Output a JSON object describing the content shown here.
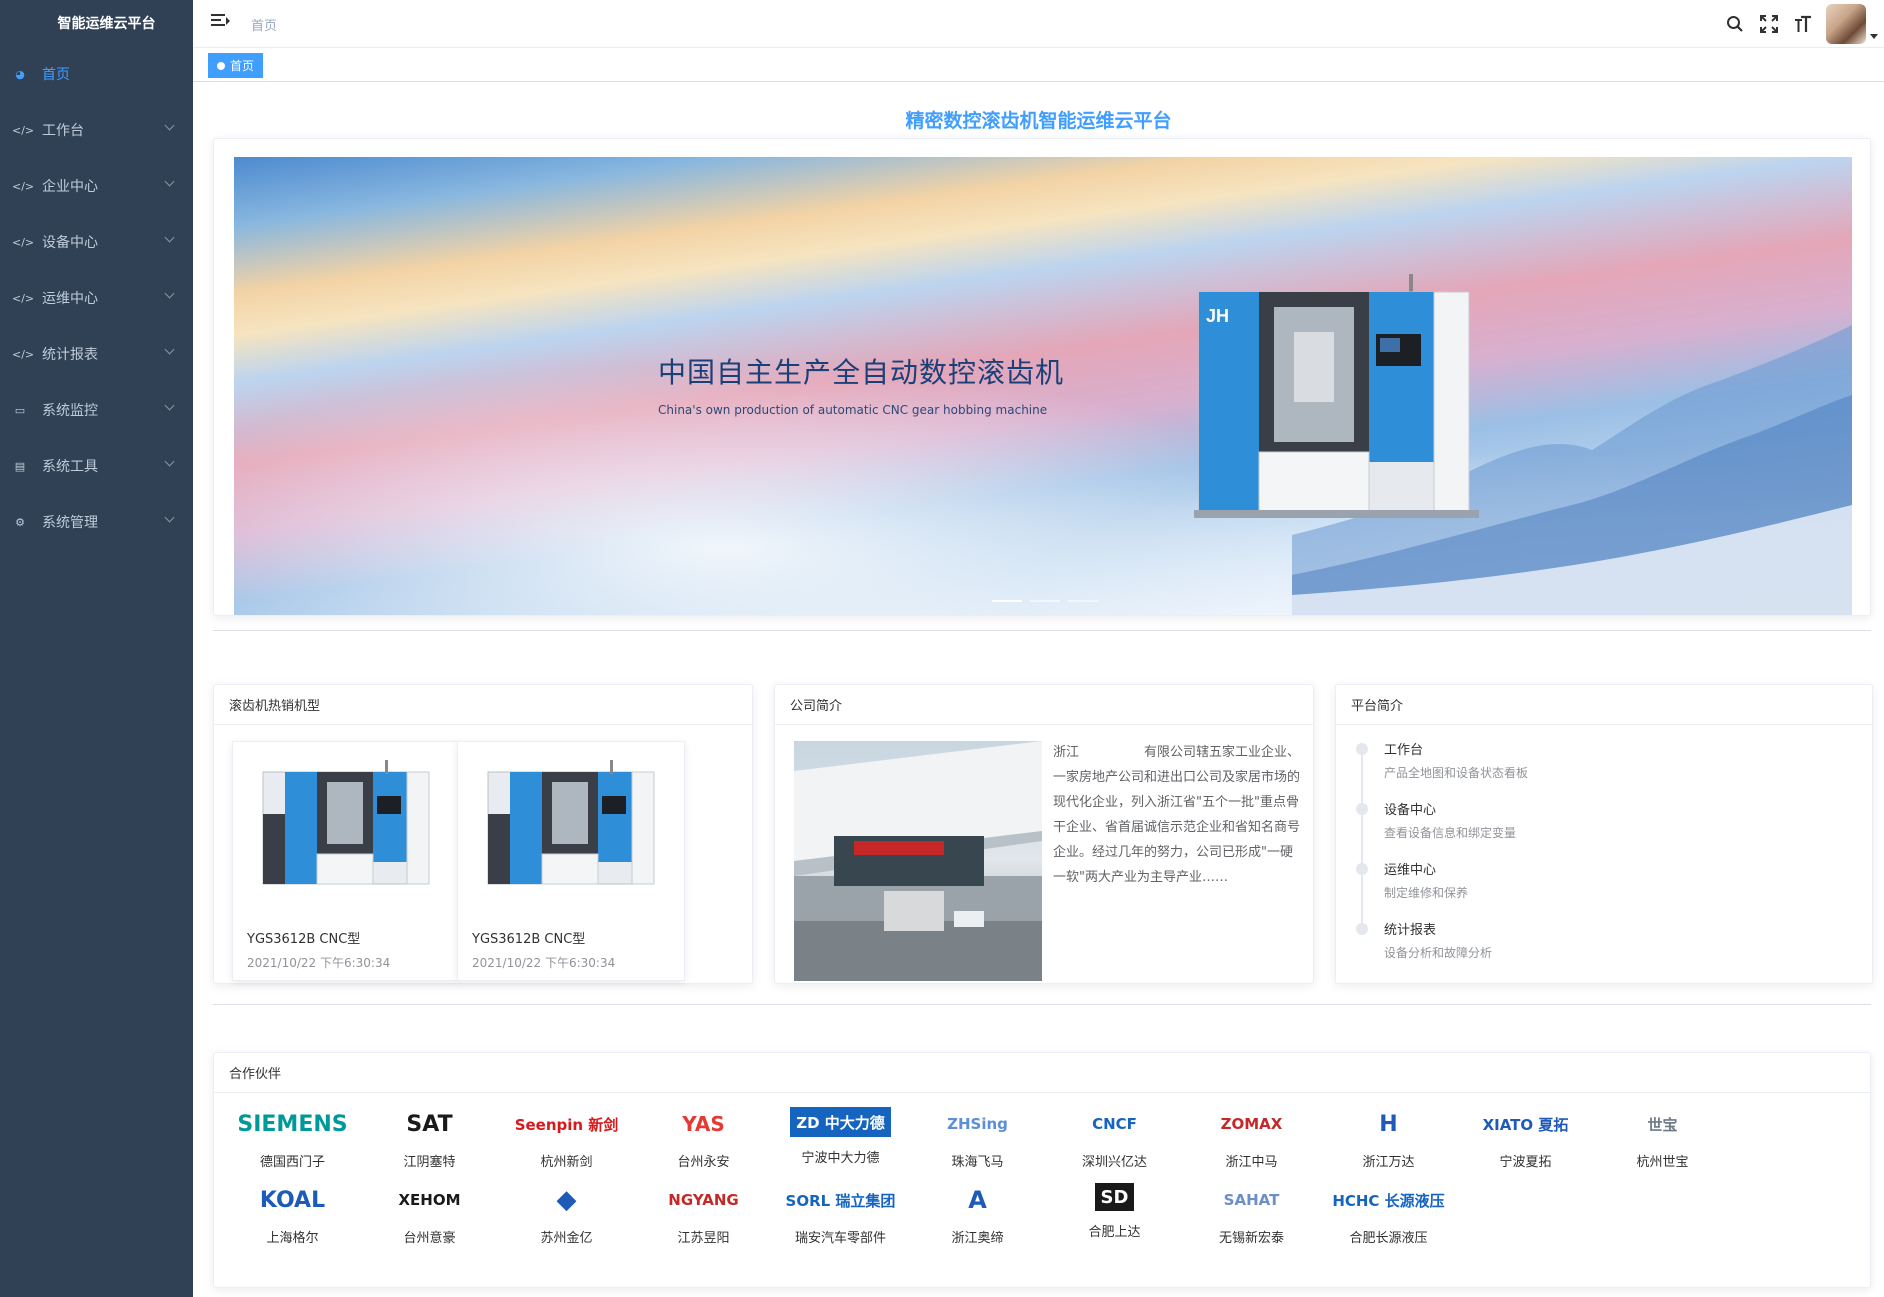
{
  "app": {
    "title": "智能运维云平台"
  },
  "sidebar": {
    "items": [
      {
        "label": "首页",
        "icon": "dashboard-icon",
        "active": true,
        "has_children": false
      },
      {
        "label": "工作台",
        "icon": "code-icon",
        "has_children": true
      },
      {
        "label": "企业中心",
        "icon": "code-icon",
        "has_children": true
      },
      {
        "label": "设备中心",
        "icon": "code-icon",
        "has_children": true
      },
      {
        "label": "运维中心",
        "icon": "code-icon",
        "has_children": true
      },
      {
        "label": "统计报表",
        "icon": "code-icon",
        "has_children": true
      },
      {
        "label": "系统监控",
        "icon": "monitor-icon",
        "has_children": true
      },
      {
        "label": "系统工具",
        "icon": "toolbox-icon",
        "has_children": true
      },
      {
        "label": "系统管理",
        "icon": "gear-icon",
        "has_children": true
      }
    ]
  },
  "header": {
    "breadcrumb": "首页",
    "icons": [
      "search-icon",
      "fullscreen-icon",
      "font-size-icon"
    ],
    "avatar": "user-avatar"
  },
  "tags": {
    "active": "首页"
  },
  "main": {
    "title": "精密数控滚齿机智能运维云平台",
    "banner": {
      "title": "中国自主生产全自动数控滚齿机",
      "subtitle": "China's own production of automatic CNC gear hobbing machine",
      "machine_logo": "JH",
      "slides": 3,
      "active_slide": 0
    },
    "hot": {
      "header": "滚齿机热销机型",
      "products": [
        {
          "name": "YGS3612B CNC型",
          "time": "2021/10/22 下午6:30:34"
        },
        {
          "name": "YGS3612B CNC型",
          "time": "2021/10/22 下午6:30:34"
        }
      ]
    },
    "company": {
      "header": "公司简介",
      "text": "浙江　　　　　有限公司辖五家工业企业、一家房地产公司和进出口公司及家居市场的现代化企业，列入浙江省\"五个一批\"重点骨干企业、省首届诚信示范企业和省知名商号企业。经过几年的努力，公司已形成\"一硬一软\"两大产业为主导产业……"
    },
    "platform": {
      "header": "平台简介",
      "items": [
        {
          "title": "工作台",
          "desc": "产品全地图和设备状态看板"
        },
        {
          "title": "设备中心",
          "desc": "查看设备信息和绑定变量"
        },
        {
          "title": "运维中心",
          "desc": "制定维修和保养"
        },
        {
          "title": "统计报表",
          "desc": "设备分析和故障分析"
        }
      ]
    },
    "partners": {
      "header": "合作伙伴",
      "items": [
        {
          "logo": "SIEMENS",
          "name": "德国西门子",
          "color": "#009999"
        },
        {
          "logo": "SAT",
          "name": "江阴塞特",
          "color": "#1a1a1a"
        },
        {
          "logo": "Seenpin 新剑",
          "name": "杭州新剑",
          "color": "#d7191c"
        },
        {
          "logo": "YAS",
          "name": "台州永安",
          "color": "#e53935"
        },
        {
          "logo": "ZD 中大力德",
          "name": "宁波中大力德",
          "color": "#1565c0"
        },
        {
          "logo": "ZHSing",
          "name": "珠海飞马",
          "color": "#5c8fd6"
        },
        {
          "logo": "CNCF",
          "name": "深圳兴亿达",
          "color": "#1565c0"
        },
        {
          "logo": "ZOMAX",
          "name": "浙江中马",
          "color": "#c62828"
        },
        {
          "logo": "H",
          "name": "浙江万达",
          "color": "#1e5bb8"
        },
        {
          "logo": "XIATO 夏拓",
          "name": "宁波夏拓",
          "color": "#1e5bb8"
        },
        {
          "logo": "世宝",
          "name": "杭州世宝",
          "color": "#6d7a88"
        },
        {
          "logo": "KOAL",
          "name": "上海格尔",
          "color": "#1e5bb8"
        },
        {
          "logo": "XEHOM",
          "name": "台州意豪",
          "color": "#1a1a1a"
        },
        {
          "logo": "◆",
          "name": "苏州金亿",
          "color": "#1e5bb8"
        },
        {
          "logo": "NGYANG",
          "name": "江苏昱阳",
          "color": "#c62828"
        },
        {
          "logo": "SORL 瑞立集团",
          "name": "瑞安汽车零部件",
          "color": "#1565c0"
        },
        {
          "logo": "A",
          "name": "浙江奥缔",
          "color": "#1e5bb8"
        },
        {
          "logo": "SD",
          "name": "合肥上达",
          "color": "#1a1a1a"
        },
        {
          "logo": "SAHAT",
          "name": "无锡新宏泰",
          "color": "#6b8fc6"
        },
        {
          "logo": "HCHC 长源液压",
          "name": "合肥长源液压",
          "color": "#1565c0"
        }
      ]
    }
  }
}
